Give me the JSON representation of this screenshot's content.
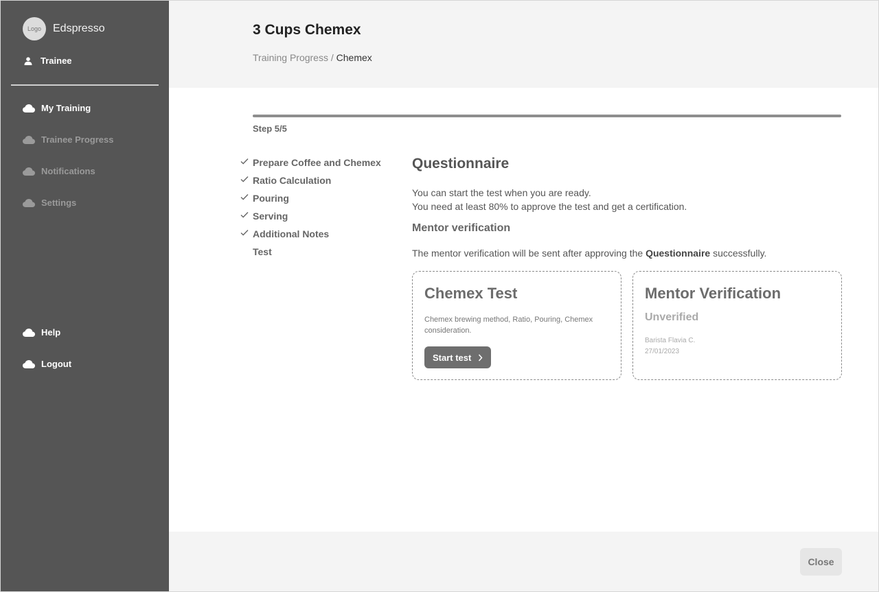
{
  "app": {
    "logo_text": "Logo",
    "name": "Edspresso"
  },
  "user": {
    "role": "Trainee"
  },
  "sidebar": {
    "items": [
      {
        "label": "My Training",
        "icon": "cloud-icon"
      },
      {
        "label": "Trainee Progress",
        "icon": "cloud-icon"
      },
      {
        "label": "Notifications",
        "icon": "cloud-icon"
      },
      {
        "label": "Settings",
        "icon": "cloud-icon"
      }
    ],
    "bottom_items": [
      {
        "label": "Help",
        "icon": "cloud-icon"
      },
      {
        "label": "Logout",
        "icon": "cloud-icon"
      }
    ]
  },
  "header": {
    "title": "3 Cups Chemex",
    "breadcrumb": {
      "parent": "Training Progress",
      "separator": "/",
      "current": "Chemex"
    }
  },
  "progress": {
    "step_label": "Step 5/5",
    "fraction": 1.0
  },
  "steps": [
    {
      "label": "Prepare Coffee and Chemex",
      "done": true
    },
    {
      "label": "Ratio Calculation",
      "done": true
    },
    {
      "label": "Pouring",
      "done": true
    },
    {
      "label": "Serving",
      "done": true
    },
    {
      "label": "Additional Notes",
      "done": true
    },
    {
      "label": "Test",
      "done": false
    }
  ],
  "questionnaire": {
    "title": "Questionnaire",
    "line1": "You can start the test when you are ready.",
    "line2": "You need at least 80% to approve the test and get a certification.",
    "mentor_heading": "Mentor verification",
    "mentor_note_before": "The mentor verification will be sent after approving the",
    "mentor_note_bold": "Questionnaire",
    "mentor_note_after": "successfully."
  },
  "cards": {
    "test": {
      "title": "Chemex Test",
      "description": "Chemex brewing method, Ratio, Pouring, Chemex consideration.",
      "button_label": "Start test"
    },
    "mentor": {
      "title": "Mentor Verification",
      "status": "Unverified",
      "mentor_name": "Barista Flavia C.",
      "date": "27/01/2023"
    }
  },
  "footer": {
    "close_label": "Close"
  },
  "colors": {
    "sidebar_bg": "#555555",
    "progress_fill": "#8e8e8e",
    "button_bg": "#6e6e6e"
  }
}
